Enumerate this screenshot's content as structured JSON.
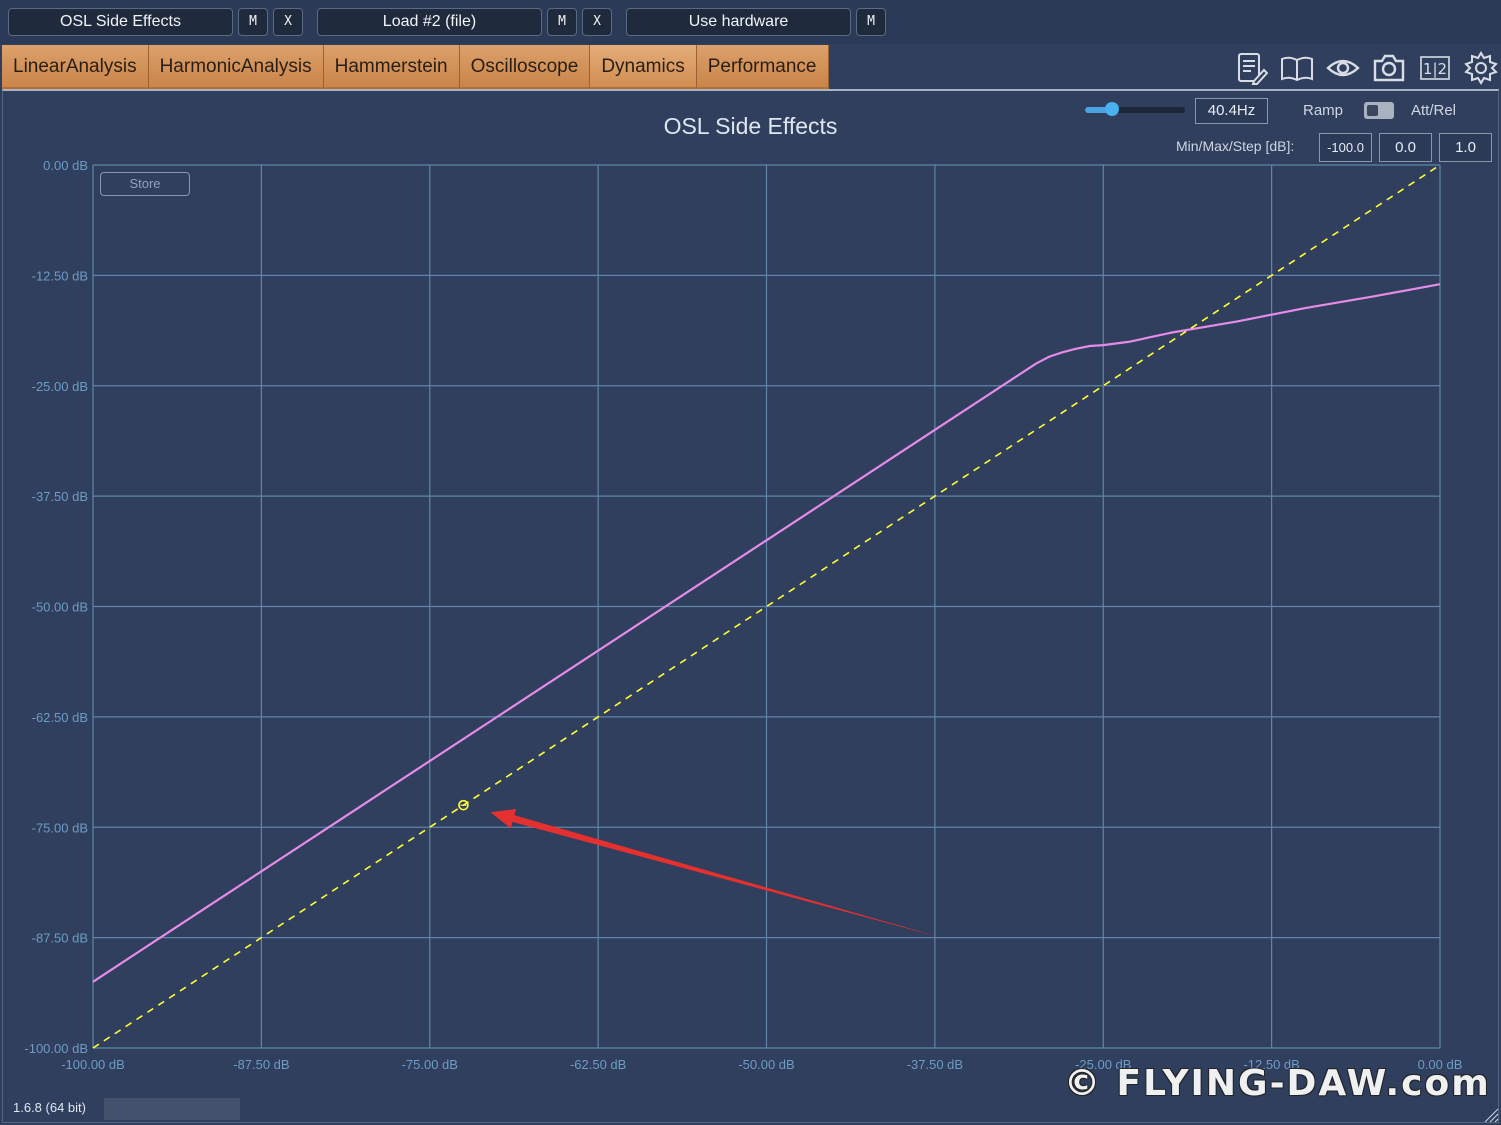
{
  "topbar": {
    "input1": {
      "label": "OSL Side Effects",
      "m": "M",
      "x": "X"
    },
    "input2": {
      "label": "Load #2 (file)",
      "m": "M",
      "x": "X"
    },
    "input3": {
      "label": "Use hardware",
      "m": "M"
    }
  },
  "tabs": [
    {
      "label": "LinearAnalysis"
    },
    {
      "label": "HarmonicAnalysis"
    },
    {
      "label": "Hammerstein"
    },
    {
      "label": "Oscilloscope"
    },
    {
      "label": "Dynamics",
      "active": true
    },
    {
      "label": "Performance"
    }
  ],
  "toolbar_icons": [
    "notes-icon",
    "book-icon",
    "eye-icon",
    "camera-icon",
    "split-view-icon",
    "gear-icon"
  ],
  "toolbar_icon_text": {
    "split": "1|2"
  },
  "controls": {
    "frequency_slider": 0.27,
    "frequency": "40.4Hz",
    "ramp_label": "Ramp",
    "att_rel_label": "Att/Rel",
    "minmax_label": "Min/Max/Step [dB]:",
    "min": "-100.0",
    "max": "0.0",
    "step": "1.0"
  },
  "store_label": "Store",
  "footer": {
    "version": "1.6.8 (64 bit)",
    "watermark": "© FLYING-DAW.com"
  },
  "colors": {
    "background": "#2f3f5d",
    "grid": "#5f86a8",
    "transfer_curve": "#e58be8",
    "reference_line": "#ffff33",
    "arrow": "#e53030",
    "tab": "#d38f56"
  },
  "chart_data": {
    "type": "line",
    "title": "OSL Side Effects",
    "xlabel": "",
    "ylabel": "",
    "xlim": [
      -100,
      0
    ],
    "ylim": [
      -100,
      0
    ],
    "x_ticks": [
      "-100.00 dB",
      "-87.50 dB",
      "-75.00 dB",
      "-62.50 dB",
      "-50.00 dB",
      "-37.50 dB",
      "-25.00 dB",
      "-12.50 dB",
      "0.00 dB"
    ],
    "y_ticks": [
      "0.00 dB",
      "-12.50 dB",
      "-25.00 dB",
      "-37.50 dB",
      "-50.00 dB",
      "-62.50 dB",
      "-75.00 dB",
      "-87.50 dB",
      "-100.00 dB"
    ],
    "grid": true,
    "series": [
      {
        "style": "solid",
        "x": [
          -100,
          -90,
          -80,
          -70,
          -60,
          -50,
          -40,
          -30,
          -29,
          -28,
          -27,
          -26,
          -25,
          -23,
          -20,
          -15,
          -10,
          -5,
          0
        ],
        "y": [
          -92.5,
          -82.5,
          -72.5,
          -62.5,
          -52.5,
          -42.5,
          -32.5,
          -22.5,
          -21.7,
          -21.2,
          -20.8,
          -20.5,
          -20.4,
          -20.0,
          -19.0,
          -17.7,
          -16.2,
          -14.9,
          -13.5
        ]
      },
      {
        "style": "dashed",
        "x": [
          -100,
          0
        ],
        "y": [
          -100,
          0
        ]
      }
    ],
    "marker": {
      "x": -72.5,
      "y": -72.5
    },
    "arrow": {
      "from": {
        "x": -37,
        "y": -87.5
      },
      "to": {
        "x": -70.5,
        "y": -73.3
      }
    }
  }
}
